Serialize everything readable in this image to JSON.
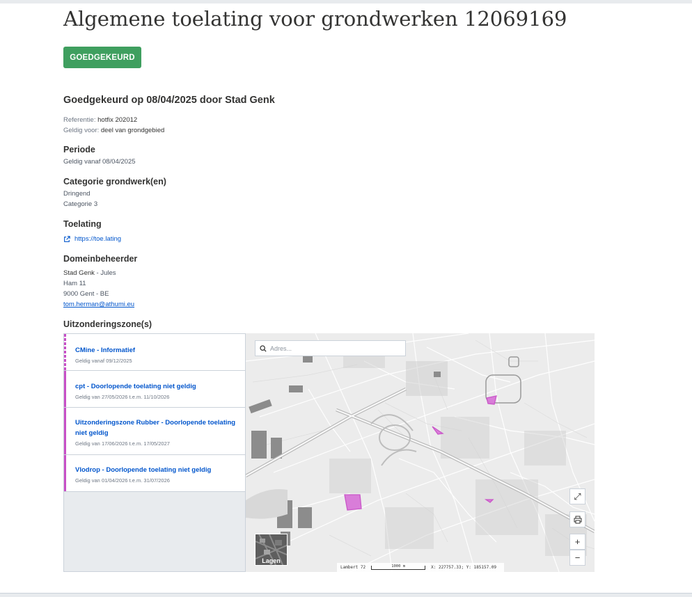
{
  "page": {
    "title": "Algemene toelating voor grondwerken 12069169",
    "status_badge": "GOEDGEKEURD",
    "approval_heading": "Goedgekeurd op 08/04/2025 door Stad Genk",
    "reference_label": "Referentie:",
    "reference_value": "hotfix 202012",
    "valid_for_label": "Geldig voor:",
    "valid_for_value": "deel van grondgebied"
  },
  "periode": {
    "heading": "Periode",
    "text": "Geldig vanaf 08/04/2025"
  },
  "categorie": {
    "heading": "Categorie grondwerk(en)",
    "items": [
      "Dringend",
      "Categorie 3"
    ]
  },
  "toelating": {
    "heading": "Toelating",
    "link": "https://toe.lating",
    "icon": "external-link-icon"
  },
  "domeinbeheerder": {
    "heading": "Domeinbeheerder",
    "name": "Stad Genk",
    "contact": " - Jules",
    "street": "Ham 11",
    "city": "9000 Gent - BE",
    "email": "tom.herman@athumi.eu"
  },
  "zones": {
    "heading": "Uitzonderingszone(s)",
    "items": [
      {
        "name": "CMine - Informatief",
        "dates": "Geldig vanaf 09/12/2025"
      },
      {
        "name": "cpt - Doorlopende toelating niet geldig",
        "dates": "Geldig van 27/05/2026 t.e.m. 11/10/2026"
      },
      {
        "name": "Uitzonderingszone Rubber - Doorlopende toelating niet geldig",
        "dates": "Geldig van 17/06/2026 t.e.m. 17/05/2027"
      },
      {
        "name": "Vlodrop - Doorlopende toelating niet geldig",
        "dates": "Geldig van 01/04/2026 t.e.m. 31/07/2026"
      }
    ]
  },
  "map": {
    "search_placeholder": "Adres...",
    "layers_label": "Lagen",
    "projection": "Lambert 72",
    "scale": "1000 m",
    "coordinates": "X: 227757.33; Y: 185157.09",
    "zone_color": "#c84fc7",
    "buttons": {
      "fullscreen": "⤢",
      "zoom_in": "+",
      "zoom_out": "−"
    }
  },
  "colors": {
    "approved_green": "#3f9f5f",
    "link_blue": "#0055cc",
    "zone_magenta": "#c84fc7"
  }
}
